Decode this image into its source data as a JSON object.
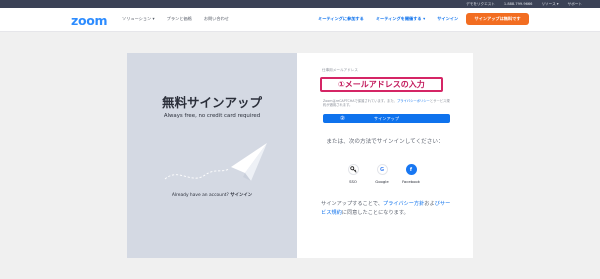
{
  "topbar": {
    "items": [
      "デモをリクエスト",
      "1.888.799.9666",
      "リソース ▾",
      "サポート"
    ]
  },
  "nav": {
    "logo": "zoom",
    "left_items": [
      "ソリューション ▾",
      "プランと価格",
      "お問い合わせ"
    ],
    "right_items": [
      "ミーティングに参加する",
      "ミーティングを開催する ▾",
      "サインイン"
    ],
    "signup_button": "サインアップは無料です"
  },
  "left_panel": {
    "title": "無料サインアップ",
    "subtitle": "Always free, no credit card required",
    "have_account": "Already have an account?",
    "sign_in_link": "サインイン"
  },
  "form": {
    "email_label": "仕事用メールアドレス",
    "email_annotation": "①メールアドレスの入力",
    "recaptcha_text": "ZoomはreCAPTCHAで保護されています。また、",
    "recaptcha_link": "プライバシーポリシー",
    "recaptcha_text2": "とサービス規約が適用されます。",
    "submit_step": "②",
    "submit_button": "サインアップ",
    "or_text": "または、次の方法でサインインしてください：",
    "social": [
      {
        "label": "SSO",
        "icon": "key-icon",
        "glyph": "🔑"
      },
      {
        "label": "Google",
        "icon": "google-icon",
        "glyph": "G"
      },
      {
        "label": "Facebook",
        "icon": "facebook-icon",
        "glyph": "f"
      }
    ],
    "terms_prefix": "サインアップすることで、",
    "terms_privacy": "プライバシー方針",
    "terms_mid": "およ",
    "terms_service": "びサービス規約",
    "terms_suffix": "に同意したことになります。"
  },
  "colors": {
    "accent_blue": "#0e72ed",
    "orange": "#f26d21",
    "annotation": "#d52565",
    "panel": "#d4d9e3"
  }
}
